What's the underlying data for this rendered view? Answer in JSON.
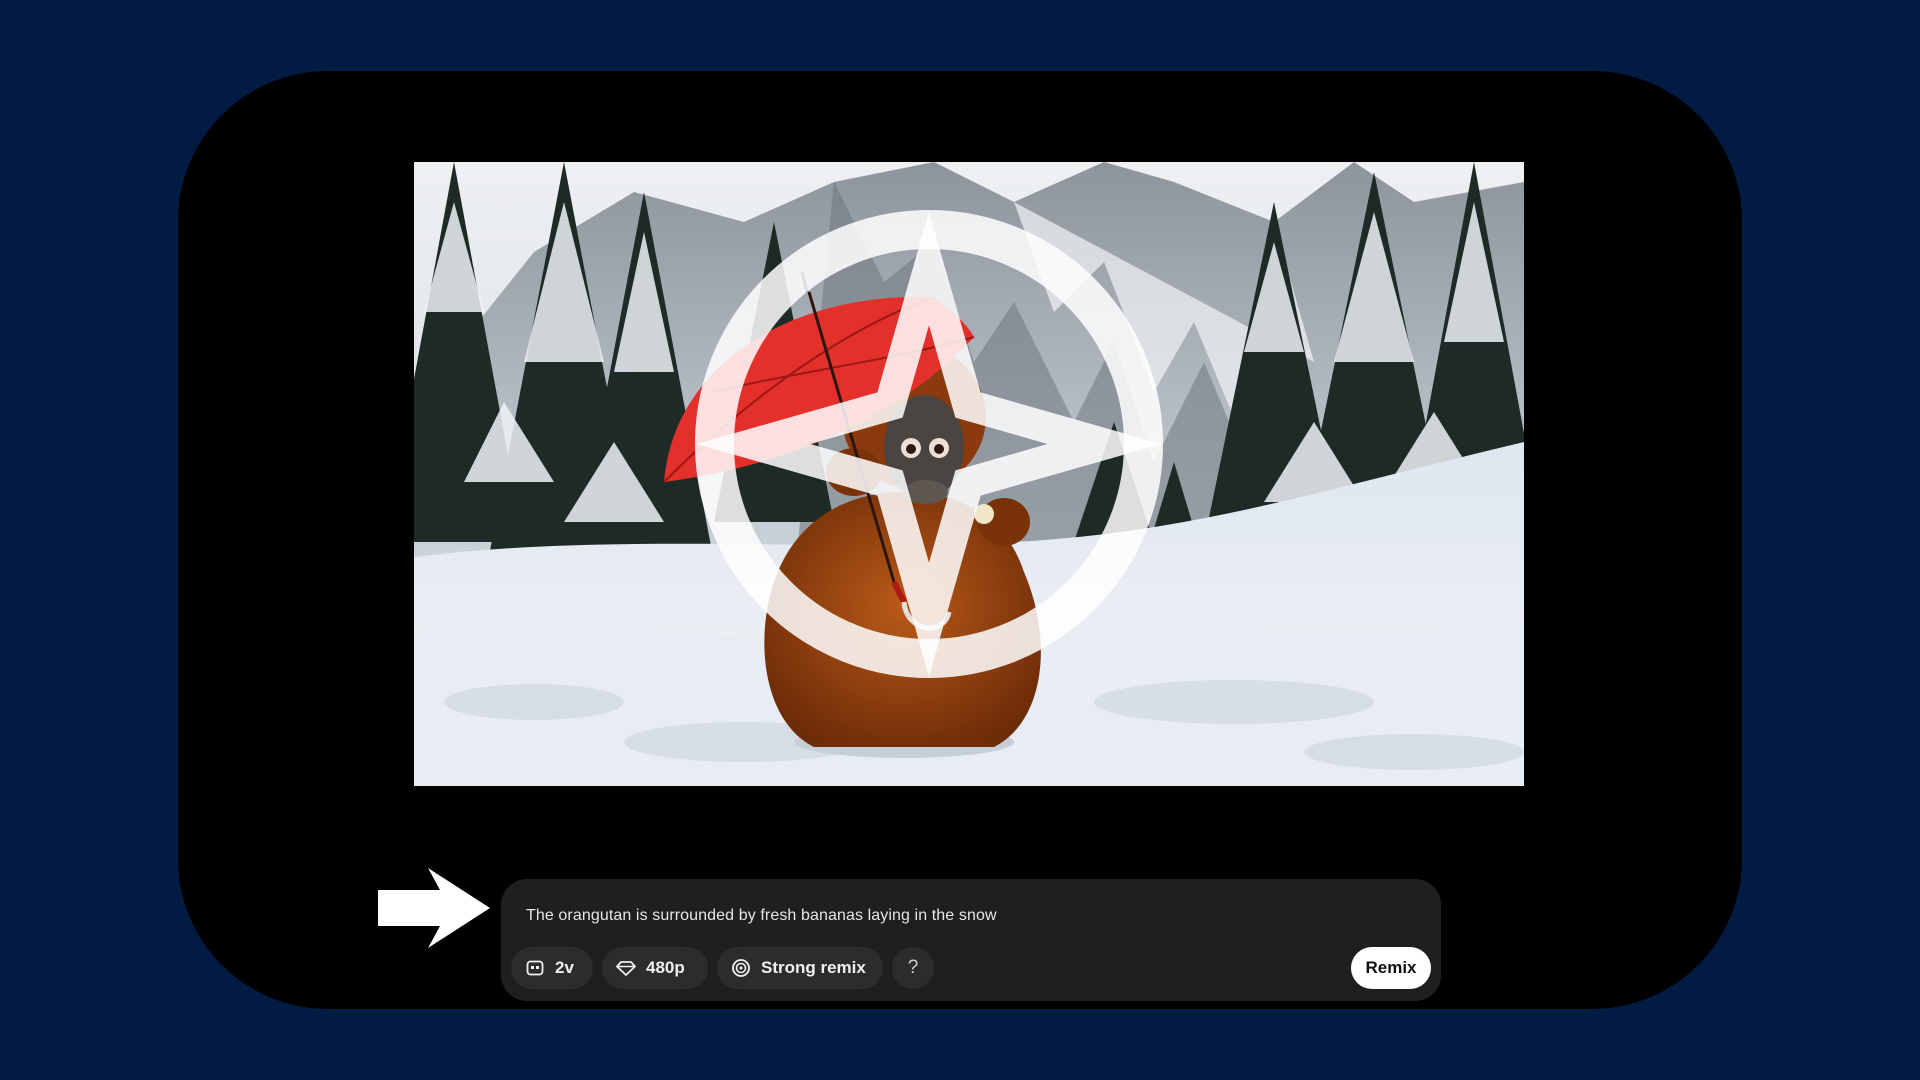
{
  "prompt": {
    "text": "The orangutan is surrounded by fresh bananas laying in the snow"
  },
  "toolbar": {
    "variations_label": "2v",
    "variations_icon": "variations-icon",
    "resolution_label": "480p",
    "resolution_icon": "diamond-icon",
    "remix_strength_label": "Strong remix",
    "remix_strength_icon": "remix-strength-icon",
    "help_label": "?",
    "remix_button_label": "Remix"
  },
  "colors": {
    "background": "#021b42",
    "device": "#000000",
    "composer": "#1f1f1f",
    "chip": "#2c2c2c",
    "umbrella": "#e3302b",
    "orangutan": "#a5450f"
  }
}
